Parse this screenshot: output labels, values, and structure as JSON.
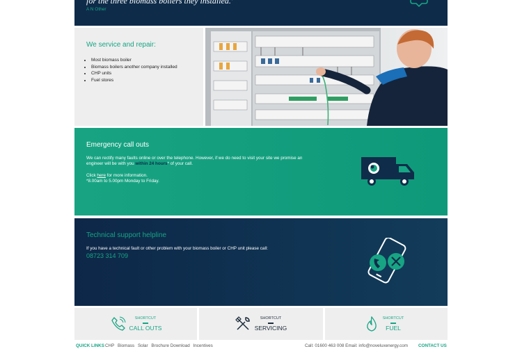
{
  "quote": {
    "text": "for the three biomass boilers they installed.'",
    "author": "A N Other"
  },
  "service": {
    "title": "We service and repair:",
    "items": [
      "Most biomass boiler",
      "Biomass boilers another company installed",
      "CHP units",
      "Fuel stores"
    ]
  },
  "emergency": {
    "title": "Emergency call outs",
    "body_part1": "We can rectify many faults online or over the telephone. However, if we do need to visit your site we promise an engineer will be with you ",
    "body_bold": "within 24 hours",
    "body_part2": "* of your call.",
    "click_prefix": "Click ",
    "click_link": "here",
    "click_suffix": " for more information.",
    "hours_note": "*8.00am to 5.00pm Monday to Friday."
  },
  "technical": {
    "title": "Technical support helpline",
    "body": "If you have a technical fault or other problem with your biomass boiler or CHP unit please call:",
    "phone": "08723 314 709"
  },
  "shortcuts": [
    {
      "small": "SHORTCUT",
      "big": "CALL OUTS",
      "icon": "phone-icon"
    },
    {
      "small": "SHORTCUT",
      "big": "SERVICING",
      "icon": "tools-icon"
    },
    {
      "small": "SHORTCUT",
      "big": "FUEL",
      "icon": "flame-icon"
    }
  ],
  "footer": {
    "quick_links_label": "QUICK LINKS",
    "links": [
      "CHP",
      "Biomass",
      "Solar",
      "Brochure Download",
      "Incentives"
    ],
    "contact_info": "Call: 01600 463 008  Email: info@noveluxenergy.com",
    "contact_us": "CONTACT US"
  },
  "colors": {
    "accent": "#17a584",
    "navy": "#0e2c4a",
    "panel": "#eeeeee"
  }
}
